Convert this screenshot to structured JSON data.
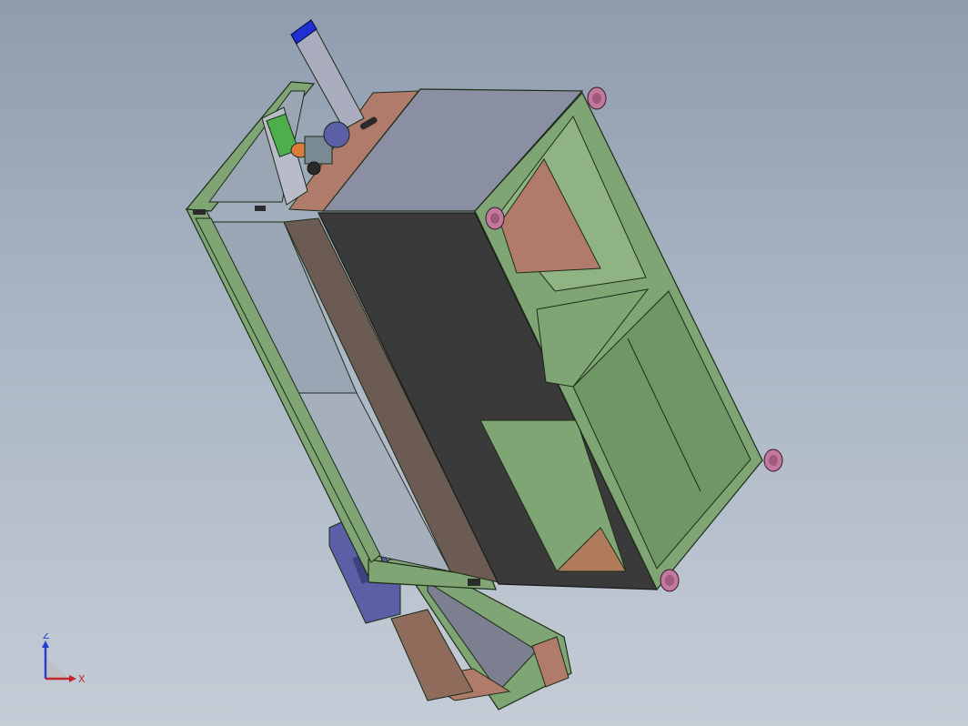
{
  "viewport": {
    "background_top": "#8e9cae",
    "background_bottom": "#c4ccd6"
  },
  "model": {
    "frame_color": "#7fa574",
    "frame_edge_color": "#1d2b18",
    "panel_dark_color": "#3a3a3a",
    "panel_grey_color": "#8a8fa3",
    "panel_copper_color": "#b07b6b",
    "glass_color": "#9aa6b4",
    "leveling_foot_color": "#c27a9c",
    "actuator_color": "#5a5fa6",
    "actuator_cap_color": "#1f2fd0"
  },
  "triad": {
    "z_label": "Z",
    "x_label": "X",
    "z_color": "#2a3ed0",
    "x_color": "#c0262c",
    "y_color": "#c0c0c0"
  }
}
